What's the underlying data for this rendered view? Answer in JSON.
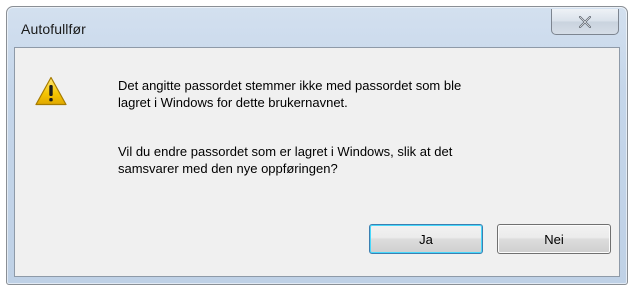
{
  "window": {
    "title": "Autofullfør"
  },
  "titlebar": {
    "close_icon": "close-x-icon"
  },
  "message": {
    "icon": "warning-icon",
    "paragraph1_line1": "Det angitte passordet stemmer ikke med passordet som ble",
    "paragraph1_line2": "lagret i Windows for dette brukernavnet.",
    "paragraph2_line1": "Vil du endre passordet som er lagret i Windows, slik at det",
    "paragraph2_line2": "samsvarer med den nye oppføringen?"
  },
  "buttons": {
    "yes_label": "Ja",
    "no_label": "Nei"
  },
  "colors": {
    "frame": "#c5d6ea",
    "client": "#f0f0f0",
    "default_button_focus": "#48d8fb",
    "warning_yellow": "#f5c400"
  }
}
